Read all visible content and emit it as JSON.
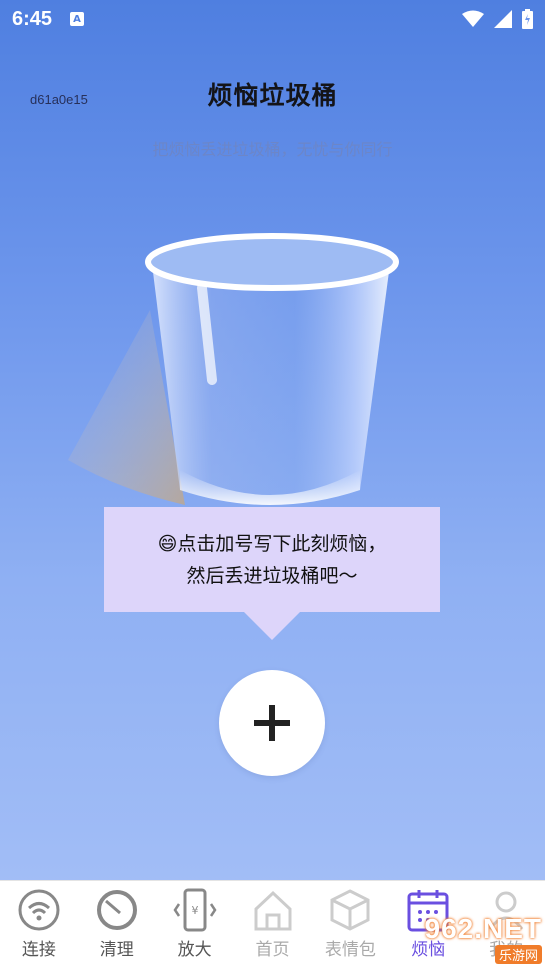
{
  "status_bar": {
    "time": "6:45",
    "notification_letter": "A"
  },
  "page": {
    "code": "d61a0e15",
    "title": "烦恼垃圾桶",
    "subtitle": "把烦恼丢进垃圾桶，无忧与你同行"
  },
  "bubble": {
    "line1": "😄点击加号写下此刻烦恼，",
    "line2": "然后丢进垃圾桶吧～"
  },
  "add_button": {
    "label": "+"
  },
  "tabs": [
    {
      "label": "连接",
      "icon": "wifi-icon"
    },
    {
      "label": "清理",
      "icon": "clean-gauge-icon"
    },
    {
      "label": "放大",
      "icon": "magnify-phone-icon"
    },
    {
      "label": "首页",
      "icon": "home-icon"
    },
    {
      "label": "表情包",
      "icon": "cube-icon"
    },
    {
      "label": "烦恼",
      "icon": "calendar-icon"
    },
    {
      "label": "我的",
      "icon": "user-icon"
    }
  ],
  "watermark": {
    "top": "962.NET",
    "bottom": "乐游网"
  },
  "colors": {
    "accent": "#6a4fe0",
    "bubble": "#ddd5fa",
    "background_top": "#4f7fe0"
  }
}
